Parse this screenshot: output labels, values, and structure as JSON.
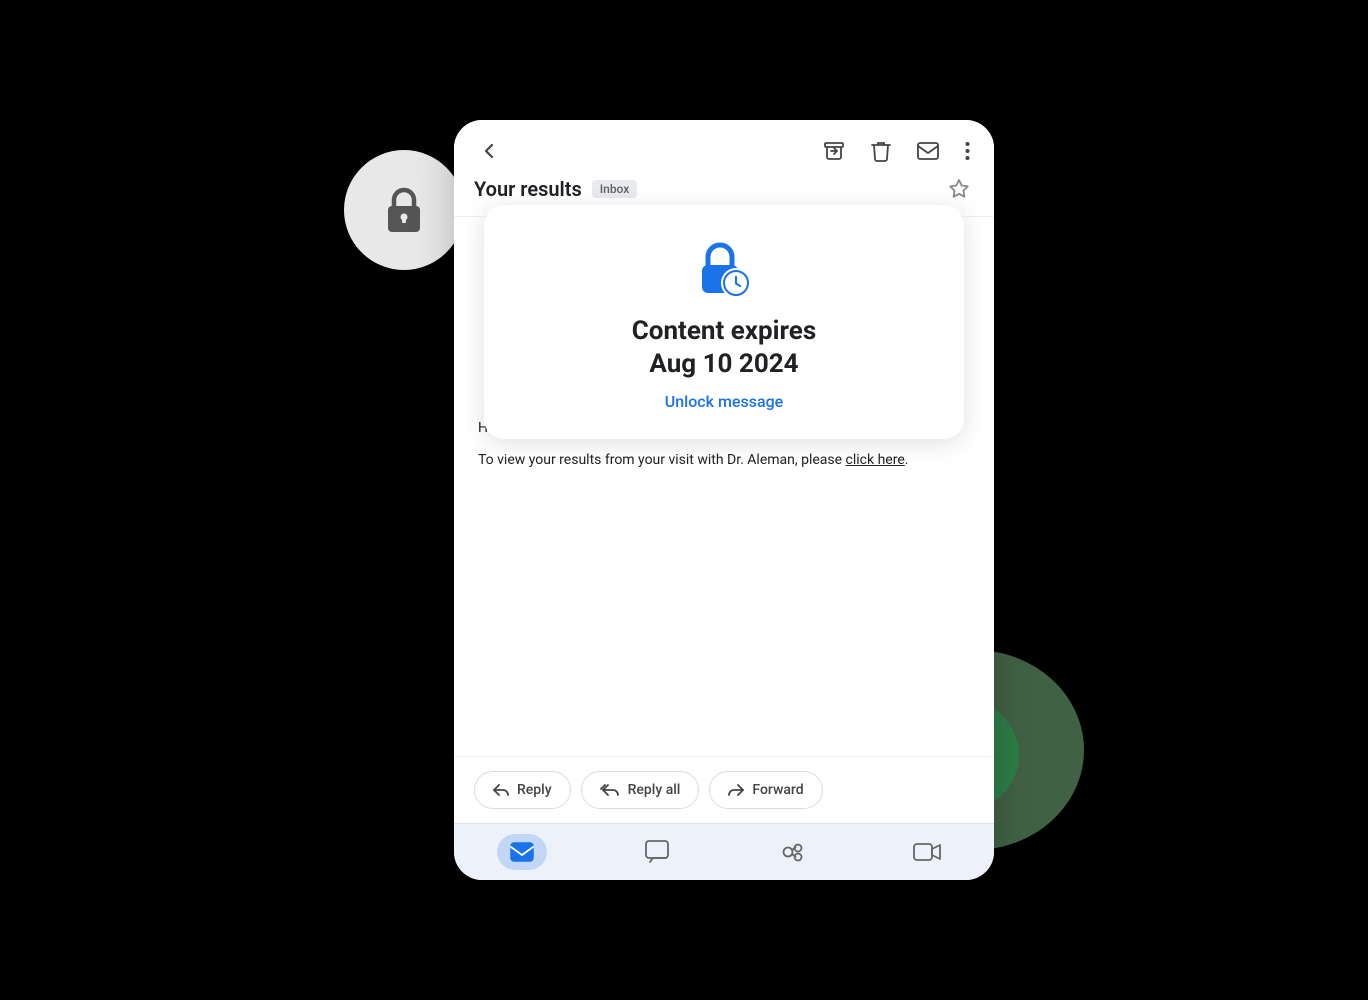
{
  "scene": {
    "lock_circle": {
      "aria": "lock-icon"
    },
    "eye_circle": {
      "aria": "eye-icon"
    }
  },
  "email": {
    "subject": "Your results",
    "badge": "Inbox",
    "expiry": {
      "title_line1": "Content expires",
      "title_line2": "Aug 10 2024",
      "unlock_label": "Unlock message"
    },
    "body": {
      "greeting": "Hi Kim,",
      "paragraph": "To view your results from your visit with Dr. Aleman, please ",
      "link_text": "click here",
      "period": "."
    },
    "actions": {
      "reply": "Reply",
      "reply_all": "Reply all",
      "forward": "Forward"
    },
    "bottom_nav": {
      "mail_label": "Mail",
      "chat_label": "Chat",
      "spaces_label": "Spaces",
      "meet_label": "Meet"
    }
  }
}
